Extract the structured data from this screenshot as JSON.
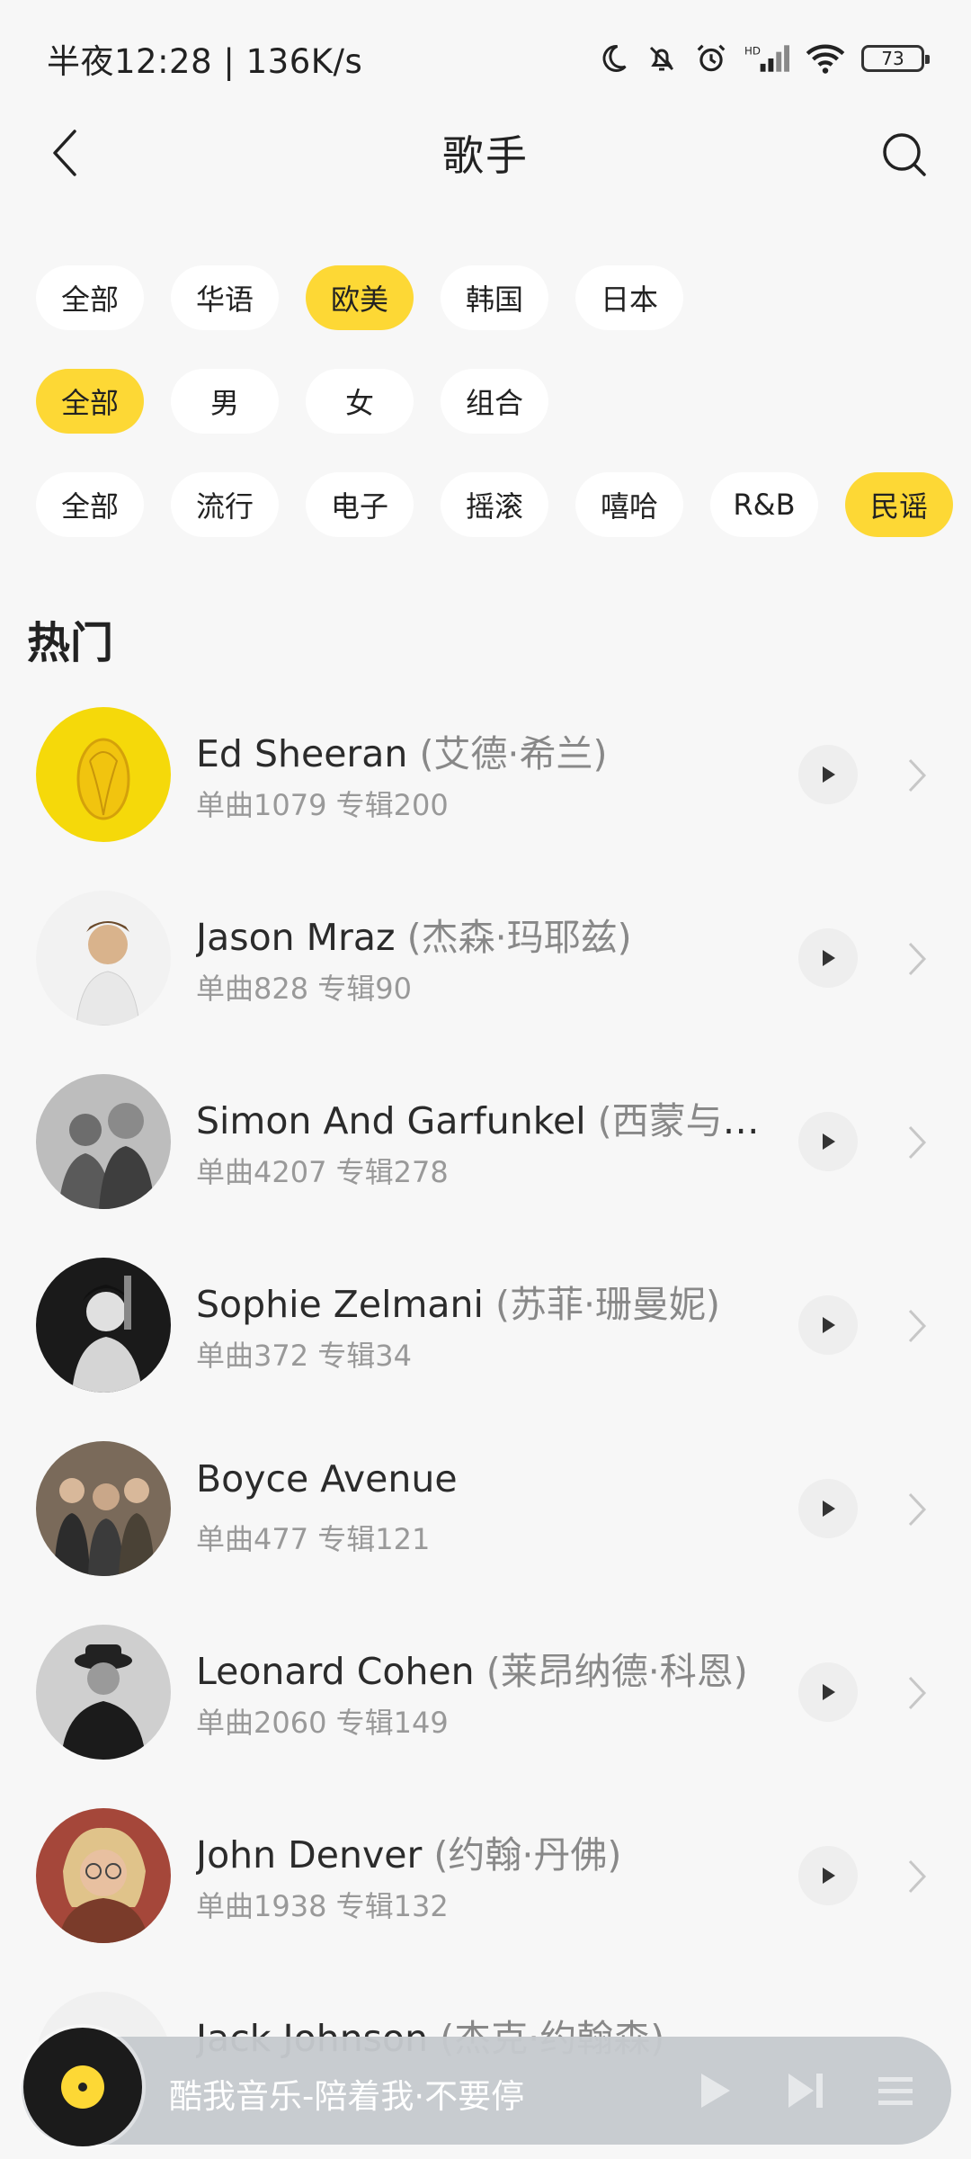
{
  "status_bar": {
    "time": "半夜12:28 | 136K/s",
    "battery": "73",
    "icons": [
      "moon-icon",
      "bell-off-icon",
      "alarm-icon",
      "hd-signal-icon",
      "wifi-icon",
      "battery-icon"
    ]
  },
  "header": {
    "title": "歌手",
    "back_icon": "back-arrow-icon",
    "search_icon": "search-icon"
  },
  "filters": {
    "region": {
      "options": [
        "全部",
        "华语",
        "欧美",
        "韩国",
        "日本"
      ],
      "selected": "欧美"
    },
    "gender": {
      "options": [
        "全部",
        "男",
        "女",
        "组合"
      ],
      "selected": "全部"
    },
    "genre": {
      "options": [
        "全部",
        "流行",
        "电子",
        "摇滚",
        "嘻哈",
        "R&B",
        "民谣"
      ],
      "selected": "民谣"
    }
  },
  "section": {
    "title": "热门"
  },
  "artists": [
    {
      "name": "Ed Sheeran",
      "cn": "(艾德·希兰)",
      "stats": "单曲1079 专辑200"
    },
    {
      "name": "Jason Mraz",
      "cn": "(杰森·玛耶兹)",
      "stats": "单曲828 专辑90"
    },
    {
      "name": "Simon And Garfunkel",
      "cn": "(西蒙与加…",
      "stats": "单曲4207 专辑278"
    },
    {
      "name": "Sophie Zelmani",
      "cn": "(苏菲·珊曼妮)",
      "stats": "单曲372 专辑34"
    },
    {
      "name": "Boyce Avenue",
      "cn": "",
      "stats": "单曲477 专辑121"
    },
    {
      "name": "Leonard Cohen",
      "cn": "(莱昂纳德·科恩)",
      "stats": "单曲2060 专辑149"
    },
    {
      "name": "John Denver",
      "cn": "(约翰·丹佛)",
      "stats": "单曲1938 专辑132"
    },
    {
      "name": "Jack Johnson",
      "cn": "(杰克·约翰森)",
      "stats": ""
    }
  ],
  "player": {
    "text": "酷我音乐-陪着我·不要停",
    "controls": [
      "play-icon",
      "next-icon",
      "playlist-icon"
    ]
  },
  "colors": {
    "accent": "#fdd835",
    "background": "#f7f7f7"
  }
}
